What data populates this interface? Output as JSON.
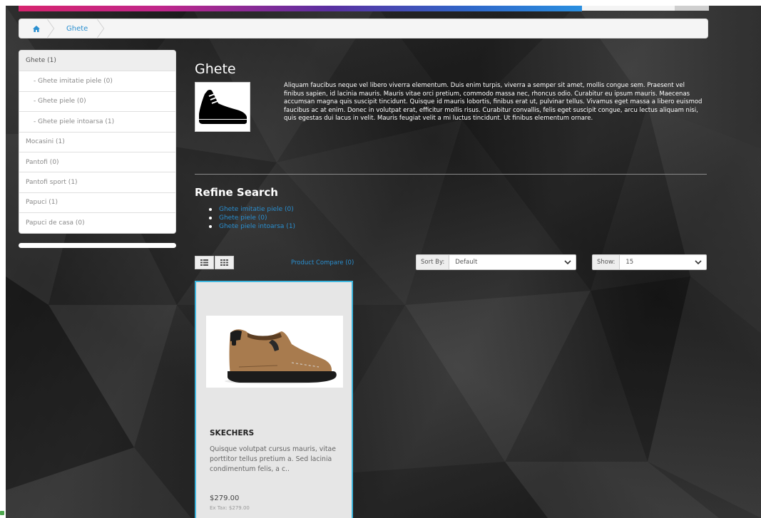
{
  "colors": {
    "link": "#2a8fd0",
    "card_border": "#3fb6de",
    "background": "#2a2a2a"
  },
  "breadcrumb": {
    "home_icon": "home-icon",
    "items": [
      {
        "label": "Ghete"
      }
    ]
  },
  "sidebar": {
    "items": [
      {
        "label": "Ghete (1)"
      },
      {
        "label": "- Ghete imitatie piele (0)"
      },
      {
        "label": "- Ghete piele (0)"
      },
      {
        "label": "- Ghete piele intoarsa (1)"
      },
      {
        "label": "Mocasini (1)"
      },
      {
        "label": "Pantofi (0)"
      },
      {
        "label": "Pantofi sport (1)"
      },
      {
        "label": "Papuci (1)"
      },
      {
        "label": "Papuci de casa (0)"
      }
    ]
  },
  "category": {
    "title": "Ghete",
    "icon": "sneaker-icon",
    "description": "Aliquam faucibus neque vel libero viverra elementum. Duis enim turpis, viverra a semper sit amet, mollis congue sem. Praesent vel finibus sapien, id lacinia mauris. Mauris vitae orci pretium, commodo massa nec, rhoncus odio. Curabitur eu ipsum mauris. Maecenas accumsan magna quis suscipit tincidunt. Quisque id mauris lobortis, finibus erat ut, pulvinar tellus. Vivamus eget massa a libero euismod faucibus ac at enim. Donec in volutpat erat, efficitur mollis risus. Curabitur convallis, felis eget suscipit congue, arcu lectus aliquam nisi, quis egestas dui lacus in velit. Mauris feugiat velit a mi luctus tincidunt. Ut finibus elementum ornare."
  },
  "refine": {
    "title": "Refine Search",
    "links": [
      {
        "label": "Ghete imitatie piele (0)"
      },
      {
        "label": "Ghete piele (0)"
      },
      {
        "label": "Ghete piele intoarsa (1)"
      }
    ]
  },
  "toolbar": {
    "list_view_icon": "list-view-icon",
    "grid_view_icon": "grid-view-icon",
    "compare_label": "Product Compare (0)",
    "sort_label": "Sort By:",
    "sort_value": "Default",
    "show_label": "Show:",
    "show_value": "15"
  },
  "product": {
    "name": "SKECHERS",
    "description": "Quisque volutpat cursus mauris, vitae porttitor tellus pretium a. Sed lacinia condimentum felis, a c..",
    "price": "$279.00",
    "ex_tax": "Ex Tax: $279.00"
  }
}
